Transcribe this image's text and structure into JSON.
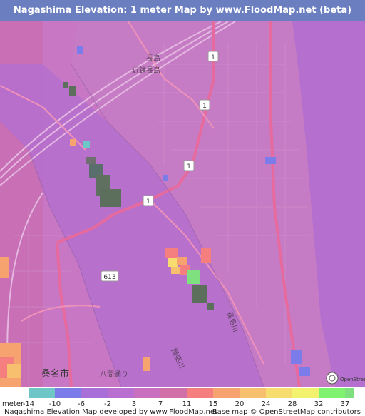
{
  "header": {
    "title": "Nagashima Elevation: 1 meter Map by www.FloodMap.net (beta)"
  },
  "map": {
    "place_labels": {
      "nagashima_station": "長島",
      "kintetsu_nagashima": "近鉄長島",
      "kuwana_city": "桑名市",
      "nagashima_gawa_lower": "長島川",
      "hatta_dori": "八間通り",
      "kiso_bridge": "揖斐川"
    },
    "route_shields": [
      "1",
      "1",
      "1",
      "1",
      "613"
    ],
    "osm_watermark": "OpenStreetMap"
  },
  "legend": {
    "unit_label": "meter",
    "ticks": [
      "-14",
      "-10",
      "-6",
      "-2",
      "3",
      "7",
      "11",
      "15",
      "20",
      "24",
      "28",
      "32",
      "37"
    ],
    "colors": [
      "#6fc6c6",
      "#7b7bea",
      "#a86fd8",
      "#b96fcf",
      "#c86fc0",
      "#d06fa8",
      "#f57f7f",
      "#f7a36f",
      "#f7c06f",
      "#f7dc6f",
      "#f2f26f",
      "#7ff26f",
      "#7fe07f"
    ]
  },
  "footer": {
    "left": "Nagashima Elevation Map developed by www.FloodMap.net",
    "right": "Base map © OpenStreetMap contributors"
  }
}
